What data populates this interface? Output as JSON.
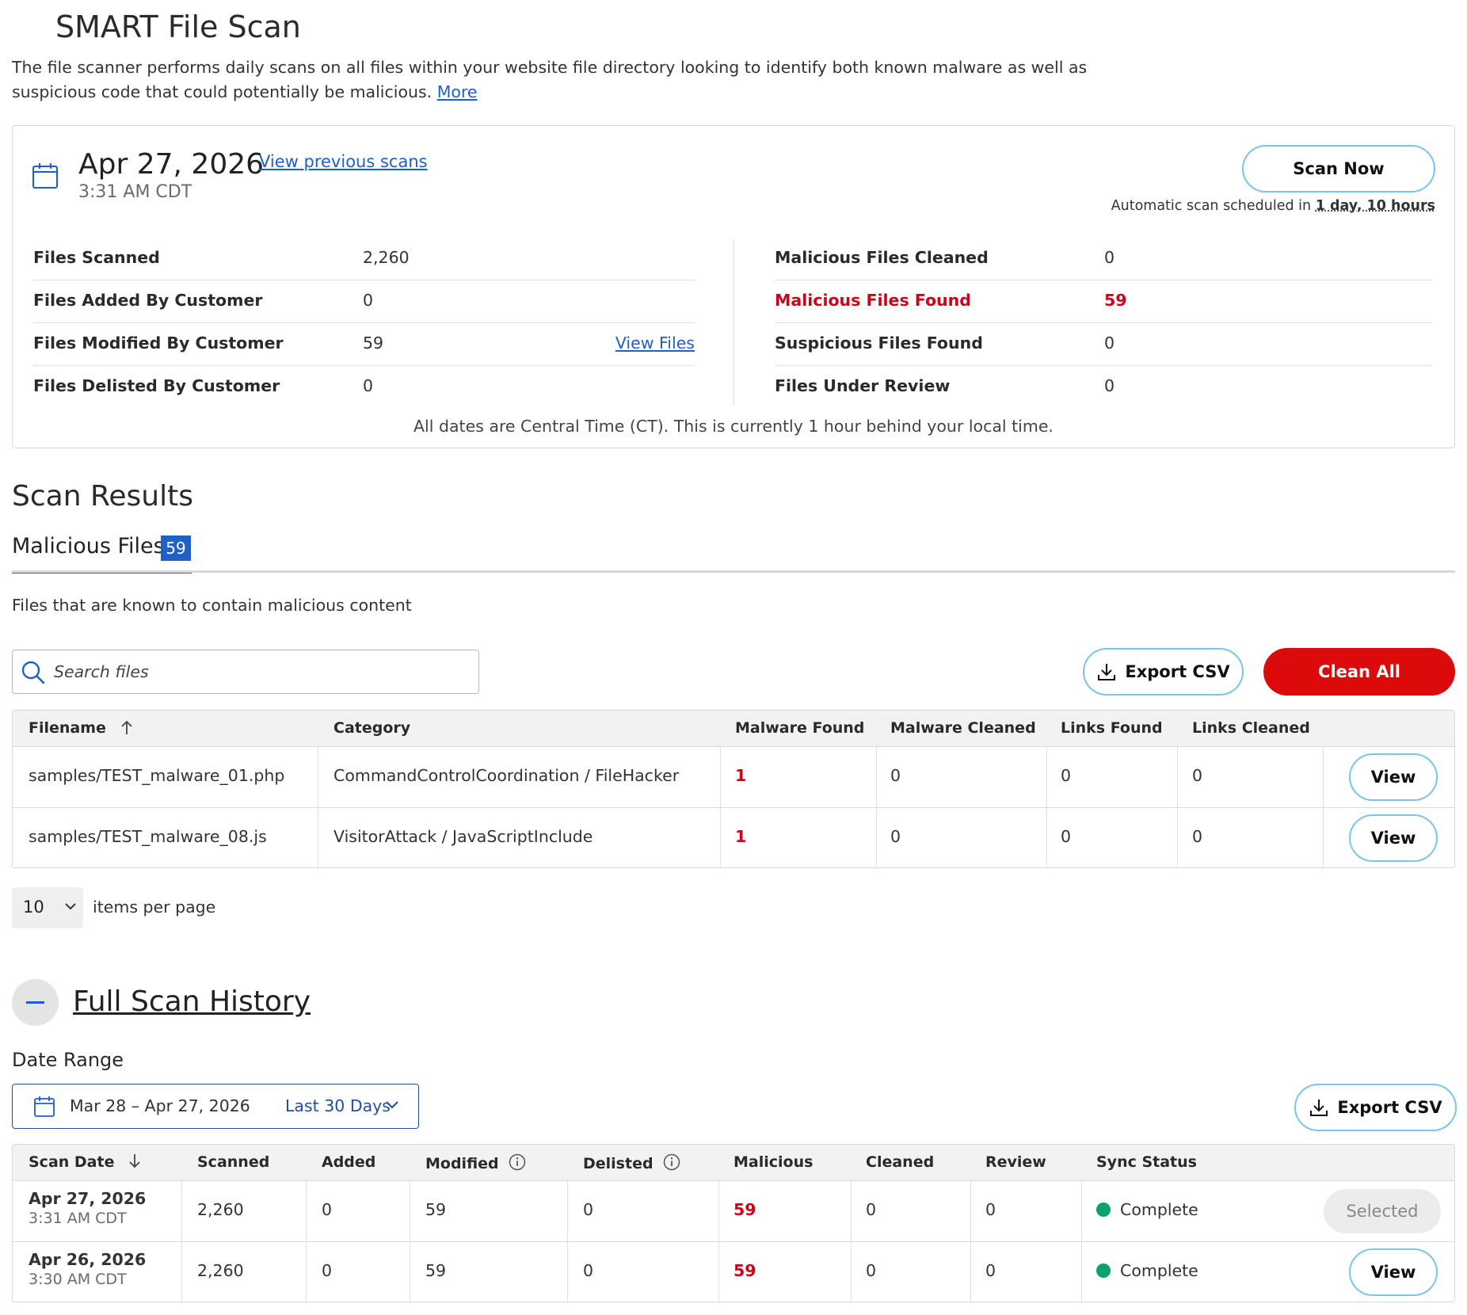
{
  "page": {
    "title": "SMART File Scan",
    "intro": "The file scanner performs daily scans on all files within your website file directory looking to identify both known malware as well as suspicious code that could potentially be malicious.",
    "more_link": "More"
  },
  "summary": {
    "date": "Apr 27, 2026",
    "time": "3:31 AM CDT",
    "view_previous": "View previous scans",
    "scan_now": "Scan Now",
    "auto_scan_prefix": "Automatic scan scheduled in",
    "auto_scan_value": "1 day, 10 hours",
    "left": [
      {
        "label": "Files Scanned",
        "value": "2,260"
      },
      {
        "label": "Files Added By Customer",
        "value": "0"
      },
      {
        "label": "Files Modified By Customer",
        "value": "59",
        "link": "View Files"
      },
      {
        "label": "Files Delisted By Customer",
        "value": "0"
      }
    ],
    "right": [
      {
        "label": "Malicious Files Cleaned",
        "value": "0"
      },
      {
        "label": "Malicious Files Found",
        "value": "59"
      },
      {
        "label": "Suspicious Files Found",
        "value": "0"
      },
      {
        "label": "Files Under Review",
        "value": "0"
      }
    ],
    "tz_note": "All dates are Central Time (CT). This is currently 1 hour behind your local time."
  },
  "results": {
    "title": "Scan Results",
    "tab_label": "Malicious Files",
    "tab_count": "59",
    "description": "Files that are known to contain malicious content",
    "search_placeholder": "Search files",
    "export_csv": "Export CSV",
    "clean_all": "Clean All",
    "columns": [
      "Filename",
      "Category",
      "Malware Found",
      "Malware Cleaned",
      "Links Found",
      "Links Cleaned"
    ],
    "rows": [
      {
        "filename": "samples/TEST_malware_01.php",
        "category": "CommandControlCoordination / FileHacker",
        "malware_found": "1",
        "malware_cleaned": "0",
        "links_found": "0",
        "links_cleaned": "0",
        "action": "View"
      },
      {
        "filename": "samples/TEST_malware_08.js",
        "category": "VisitorAttack / JavaScriptInclude",
        "malware_found": "1",
        "malware_cleaned": "0",
        "links_found": "0",
        "links_cleaned": "0",
        "action": "View"
      }
    ],
    "per_page_value": "10",
    "per_page_label": "items per page"
  },
  "history": {
    "title": "Full Scan History",
    "date_range_label": "Date Range",
    "date_range_text": "Mar 28 – Apr 27, 2026",
    "date_range_preset": "Last 30 Days",
    "export_csv": "Export CSV",
    "columns": [
      "Scan Date",
      "Scanned",
      "Added",
      "Modified",
      "Delisted",
      "Malicious",
      "Cleaned",
      "Review",
      "Sync Status"
    ],
    "rows": [
      {
        "date": "Apr 27, 2026",
        "time": "3:31 AM CDT",
        "scanned": "2,260",
        "added": "0",
        "modified": "59",
        "delisted": "0",
        "malicious": "59",
        "cleaned": "0",
        "review": "0",
        "status": "Complete",
        "action": "Selected"
      },
      {
        "date": "Apr 26, 2026",
        "time": "3:30 AM CDT",
        "scanned": "2,260",
        "added": "0",
        "modified": "59",
        "delisted": "0",
        "malicious": "59",
        "cleaned": "0",
        "review": "0",
        "status": "Complete",
        "action": "View"
      }
    ]
  },
  "colors": {
    "accent": "#1f5fc8",
    "danger": "#dc0a0a",
    "success": "#0ba36b",
    "button_border": "#7cc4ec"
  },
  "icons": [
    "calendar-icon",
    "search-icon",
    "download-icon",
    "sort-up-icon",
    "sort-down-icon",
    "info-icon",
    "chevron-down-icon",
    "minus-icon"
  ]
}
